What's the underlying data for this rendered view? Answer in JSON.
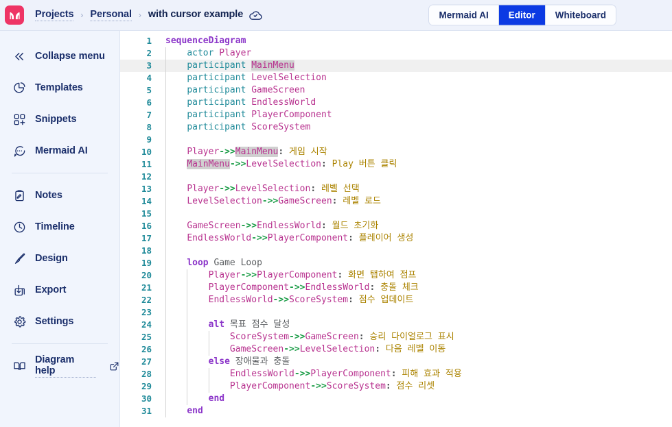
{
  "header": {
    "logo_icon": "mermaid-logo-icon",
    "logo_color": "#ee3465",
    "breadcrumbs": [
      {
        "label": "Projects",
        "current": false
      },
      {
        "label": "Personal",
        "current": false
      },
      {
        "label": "with cursor example",
        "current": true
      }
    ],
    "separator": "›",
    "cloud_icon": "cloud-check-icon",
    "tabs": [
      {
        "label": "Mermaid AI",
        "active": false
      },
      {
        "label": "Editor",
        "active": true
      },
      {
        "label": "Whiteboard",
        "active": false
      }
    ],
    "active_tab_color": "#0c3ae3"
  },
  "sidebar": {
    "items": [
      {
        "label": "Collapse menu",
        "icon": "chevrons-left-icon"
      },
      {
        "label": "Templates",
        "icon": "templates-pie-icon"
      },
      {
        "label": "Snippets",
        "icon": "snippets-grid-plus-icon"
      },
      {
        "label": "Mermaid AI",
        "icon": "chat-bubble-dots-icon"
      }
    ],
    "items2": [
      {
        "label": "Notes",
        "icon": "notes-clipboard-icon"
      },
      {
        "label": "Timeline",
        "icon": "clock-icon"
      },
      {
        "label": "Design",
        "icon": "paintbrush-icon"
      },
      {
        "label": "Export",
        "icon": "export-download-icon"
      },
      {
        "label": "Settings",
        "icon": "gear-icon"
      }
    ],
    "help": {
      "label": "Diagram help",
      "icon": "book-icon",
      "external_icon": "external-link-icon"
    }
  },
  "editor": {
    "language": "mermaid",
    "active_line": 3,
    "selection_text": "MainMenu",
    "line_count": 31,
    "lines": [
      {
        "n": 1,
        "indent": 0,
        "tokens": [
          {
            "t": "sequenceDiagram",
            "c": "t-kw"
          }
        ]
      },
      {
        "n": 2,
        "indent": 1,
        "tokens": [
          {
            "t": "actor ",
            "c": "t-decl"
          },
          {
            "t": "Player",
            "c": "t-id"
          }
        ]
      },
      {
        "n": 3,
        "indent": 1,
        "tokens": [
          {
            "t": "participant ",
            "c": "t-decl"
          },
          {
            "t": "MainMenu",
            "c": "t-id",
            "sel": true
          }
        ]
      },
      {
        "n": 4,
        "indent": 1,
        "tokens": [
          {
            "t": "participant ",
            "c": "t-decl"
          },
          {
            "t": "LevelSelection",
            "c": "t-id"
          }
        ]
      },
      {
        "n": 5,
        "indent": 1,
        "tokens": [
          {
            "t": "participant ",
            "c": "t-decl"
          },
          {
            "t": "GameScreen",
            "c": "t-id"
          }
        ]
      },
      {
        "n": 6,
        "indent": 1,
        "tokens": [
          {
            "t": "participant ",
            "c": "t-decl"
          },
          {
            "t": "EndlessWorld",
            "c": "t-id"
          }
        ]
      },
      {
        "n": 7,
        "indent": 1,
        "tokens": [
          {
            "t": "participant ",
            "c": "t-decl"
          },
          {
            "t": "PlayerComponent",
            "c": "t-id"
          }
        ]
      },
      {
        "n": 8,
        "indent": 1,
        "tokens": [
          {
            "t": "participant ",
            "c": "t-decl"
          },
          {
            "t": "ScoreSystem",
            "c": "t-id"
          }
        ]
      },
      {
        "n": 9,
        "indent": 0,
        "tokens": []
      },
      {
        "n": 10,
        "indent": 1,
        "tokens": [
          {
            "t": "Player",
            "c": "t-id"
          },
          {
            "t": "->>",
            "c": "t-arrow"
          },
          {
            "t": "MainMenu",
            "c": "t-id",
            "sel": true
          },
          {
            "t": ":",
            "c": "t-colon"
          },
          {
            "t": " 게임 시작",
            "c": "t-msg"
          }
        ]
      },
      {
        "n": 11,
        "indent": 1,
        "tokens": [
          {
            "t": "MainMenu",
            "c": "t-id",
            "sel": true
          },
          {
            "t": "->>",
            "c": "t-arrow"
          },
          {
            "t": "LevelSelection",
            "c": "t-id"
          },
          {
            "t": ":",
            "c": "t-colon"
          },
          {
            "t": " Play 버튼 클릭",
            "c": "t-msg"
          }
        ]
      },
      {
        "n": 12,
        "indent": 0,
        "tokens": []
      },
      {
        "n": 13,
        "indent": 1,
        "tokens": [
          {
            "t": "Player",
            "c": "t-id"
          },
          {
            "t": "->>",
            "c": "t-arrow"
          },
          {
            "t": "LevelSelection",
            "c": "t-id"
          },
          {
            "t": ":",
            "c": "t-colon"
          },
          {
            "t": " 레벨 선택",
            "c": "t-msg"
          }
        ]
      },
      {
        "n": 14,
        "indent": 1,
        "tokens": [
          {
            "t": "LevelSelection",
            "c": "t-id"
          },
          {
            "t": "->>",
            "c": "t-arrow"
          },
          {
            "t": "GameScreen",
            "c": "t-id"
          },
          {
            "t": ":",
            "c": "t-colon"
          },
          {
            "t": " 레벨 로드",
            "c": "t-msg"
          }
        ]
      },
      {
        "n": 15,
        "indent": 0,
        "tokens": []
      },
      {
        "n": 16,
        "indent": 1,
        "tokens": [
          {
            "t": "GameScreen",
            "c": "t-id"
          },
          {
            "t": "->>",
            "c": "t-arrow"
          },
          {
            "t": "EndlessWorld",
            "c": "t-id"
          },
          {
            "t": ":",
            "c": "t-colon"
          },
          {
            "t": " 월드 초기화",
            "c": "t-msg"
          }
        ]
      },
      {
        "n": 17,
        "indent": 1,
        "tokens": [
          {
            "t": "EndlessWorld",
            "c": "t-id"
          },
          {
            "t": "->>",
            "c": "t-arrow"
          },
          {
            "t": "PlayerComponent",
            "c": "t-id"
          },
          {
            "t": ":",
            "c": "t-colon"
          },
          {
            "t": " 플레이어 생성",
            "c": "t-msg"
          }
        ]
      },
      {
        "n": 18,
        "indent": 0,
        "tokens": []
      },
      {
        "n": 19,
        "indent": 1,
        "tokens": [
          {
            "t": "loop",
            "c": "t-kw"
          },
          {
            "t": " Game Loop",
            "c": "t-plain"
          }
        ]
      },
      {
        "n": 20,
        "indent": 2,
        "tokens": [
          {
            "t": "Player",
            "c": "t-id"
          },
          {
            "t": "->>",
            "c": "t-arrow"
          },
          {
            "t": "PlayerComponent",
            "c": "t-id"
          },
          {
            "t": ":",
            "c": "t-colon"
          },
          {
            "t": " 화면 탭하여 점프",
            "c": "t-msg"
          }
        ]
      },
      {
        "n": 21,
        "indent": 2,
        "tokens": [
          {
            "t": "PlayerComponent",
            "c": "t-id"
          },
          {
            "t": "->>",
            "c": "t-arrow"
          },
          {
            "t": "EndlessWorld",
            "c": "t-id"
          },
          {
            "t": ":",
            "c": "t-colon"
          },
          {
            "t": " 충돌 체크",
            "c": "t-msg"
          }
        ]
      },
      {
        "n": 22,
        "indent": 2,
        "tokens": [
          {
            "t": "EndlessWorld",
            "c": "t-id"
          },
          {
            "t": "->>",
            "c": "t-arrow"
          },
          {
            "t": "ScoreSystem",
            "c": "t-id"
          },
          {
            "t": ":",
            "c": "t-colon"
          },
          {
            "t": " 점수 업데이트",
            "c": "t-msg"
          }
        ]
      },
      {
        "n": 23,
        "indent": 0,
        "tokens": []
      },
      {
        "n": 24,
        "indent": 2,
        "tokens": [
          {
            "t": "alt",
            "c": "t-kw"
          },
          {
            "t": " 목표 점수 달성",
            "c": "t-plain"
          }
        ]
      },
      {
        "n": 25,
        "indent": 3,
        "tokens": [
          {
            "t": "ScoreSystem",
            "c": "t-id"
          },
          {
            "t": "->>",
            "c": "t-arrow"
          },
          {
            "t": "GameScreen",
            "c": "t-id"
          },
          {
            "t": ":",
            "c": "t-colon"
          },
          {
            "t": " 승리 다이얼로그 표시",
            "c": "t-msg"
          }
        ]
      },
      {
        "n": 26,
        "indent": 3,
        "tokens": [
          {
            "t": "GameScreen",
            "c": "t-id"
          },
          {
            "t": "->>",
            "c": "t-arrow"
          },
          {
            "t": "LevelSelection",
            "c": "t-id"
          },
          {
            "t": ":",
            "c": "t-colon"
          },
          {
            "t": " 다음 레벨 이동",
            "c": "t-msg"
          }
        ]
      },
      {
        "n": 27,
        "indent": 2,
        "tokens": [
          {
            "t": "else",
            "c": "t-kw"
          },
          {
            "t": " 장애물과 충돌",
            "c": "t-plain"
          }
        ]
      },
      {
        "n": 28,
        "indent": 3,
        "tokens": [
          {
            "t": "EndlessWorld",
            "c": "t-id"
          },
          {
            "t": "->>",
            "c": "t-arrow"
          },
          {
            "t": "PlayerComponent",
            "c": "t-id"
          },
          {
            "t": ":",
            "c": "t-colon"
          },
          {
            "t": " 피해 효과 적용",
            "c": "t-msg"
          }
        ]
      },
      {
        "n": 29,
        "indent": 3,
        "tokens": [
          {
            "t": "PlayerComponent",
            "c": "t-id"
          },
          {
            "t": "->>",
            "c": "t-arrow"
          },
          {
            "t": "ScoreSystem",
            "c": "t-id"
          },
          {
            "t": ":",
            "c": "t-colon"
          },
          {
            "t": " 점수 리셋",
            "c": "t-msg"
          }
        ]
      },
      {
        "n": 30,
        "indent": 2,
        "tokens": [
          {
            "t": "end",
            "c": "t-kw"
          }
        ]
      },
      {
        "n": 31,
        "indent": 1,
        "tokens": [
          {
            "t": "end",
            "c": "t-kw"
          }
        ]
      }
    ]
  }
}
